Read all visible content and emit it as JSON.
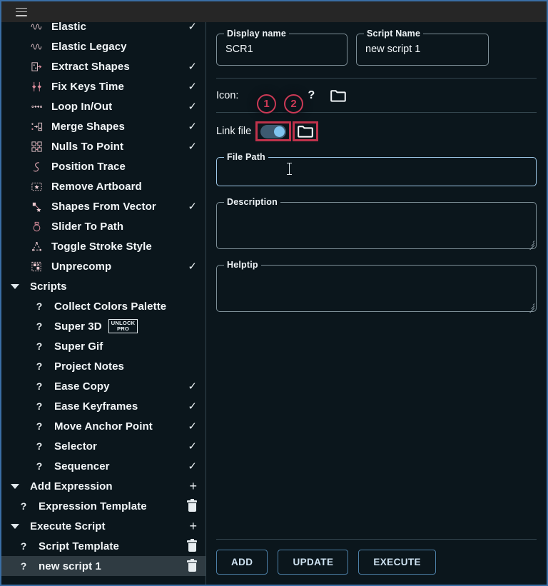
{
  "window": {
    "accent_blue": "#3a6ea5",
    "background": "#0b161c",
    "topbar_background": "#262626",
    "marker_color": "#cc3a56"
  },
  "topbar": {
    "menu_label": "menu"
  },
  "sidebar": {
    "items": [
      {
        "label": "Elastic",
        "icon": "wave-icon",
        "level": 1,
        "checked": true,
        "type": "tool"
      },
      {
        "label": "Elastic Legacy",
        "icon": "wave-icon",
        "level": 1,
        "checked": false,
        "type": "tool"
      },
      {
        "label": "Extract Shapes",
        "icon": "extract-shapes-icon",
        "level": 1,
        "checked": true,
        "type": "tool"
      },
      {
        "label": "Fix Keys Time",
        "icon": "fix-keys-time-icon",
        "level": 1,
        "checked": true,
        "type": "tool"
      },
      {
        "label": "Loop In/Out",
        "icon": "loop-in-out-icon",
        "level": 1,
        "checked": true,
        "type": "tool"
      },
      {
        "label": "Merge Shapes",
        "icon": "merge-shapes-icon",
        "level": 1,
        "checked": true,
        "type": "tool"
      },
      {
        "label": "Nulls To Point",
        "icon": "nulls-to-point-icon",
        "level": 1,
        "checked": true,
        "type": "tool"
      },
      {
        "label": "Position Trace",
        "icon": "position-trace-icon",
        "level": 1,
        "checked": false,
        "type": "tool"
      },
      {
        "label": "Remove Artboard",
        "icon": "remove-artboard-icon",
        "level": 1,
        "checked": false,
        "type": "tool"
      },
      {
        "label": "Shapes From Vector",
        "icon": "shapes-from-vector-icon",
        "level": 1,
        "checked": true,
        "type": "tool"
      },
      {
        "label": "Slider To Path",
        "icon": "slider-to-path-icon",
        "level": 1,
        "checked": false,
        "type": "tool"
      },
      {
        "label": "Toggle Stroke Style",
        "icon": "toggle-stroke-icon",
        "level": 1,
        "checked": false,
        "type": "tool"
      },
      {
        "label": "Unprecomp",
        "icon": "unprecomp-icon",
        "level": 1,
        "checked": true,
        "type": "tool"
      },
      {
        "label": "Scripts",
        "icon": "caret-down-icon",
        "level": 0,
        "checked": false,
        "type": "group"
      },
      {
        "label": "Collect Colors Palette",
        "icon": "question-icon",
        "level": 2,
        "checked": false,
        "type": "script"
      },
      {
        "label": "Super 3D",
        "icon": "question-icon",
        "level": 2,
        "checked": false,
        "type": "script",
        "badge": "UNLOCK PRO"
      },
      {
        "label": "Super Gif",
        "icon": "question-icon",
        "level": 2,
        "checked": false,
        "type": "script"
      },
      {
        "label": "Project Notes",
        "icon": "question-icon",
        "level": 2,
        "checked": false,
        "type": "script"
      },
      {
        "label": "Ease Copy",
        "icon": "question-icon",
        "level": 2,
        "checked": true,
        "type": "script"
      },
      {
        "label": "Ease Keyframes",
        "icon": "question-icon",
        "level": 2,
        "checked": true,
        "type": "script"
      },
      {
        "label": "Move Anchor Point",
        "icon": "question-icon",
        "level": 2,
        "checked": true,
        "type": "script"
      },
      {
        "label": "Selector",
        "icon": "question-icon",
        "level": 2,
        "checked": true,
        "type": "script"
      },
      {
        "label": "Sequencer",
        "icon": "question-icon",
        "level": 2,
        "checked": true,
        "type": "script"
      },
      {
        "label": "Add Expression",
        "icon": "caret-down-icon",
        "level": 0,
        "checked": false,
        "type": "group",
        "plus": "+"
      },
      {
        "label": "Expression Template",
        "icon": "question-icon",
        "level": 1,
        "checked": false,
        "type": "item",
        "trash": true
      },
      {
        "label": "Execute Script",
        "icon": "caret-down-icon",
        "level": 0,
        "checked": false,
        "type": "group",
        "plus": "+"
      },
      {
        "label": "Script Template",
        "icon": "question-icon",
        "level": 1,
        "checked": false,
        "type": "item",
        "trash": true
      },
      {
        "label": "new script 1",
        "icon": "question-icon",
        "level": 1,
        "checked": false,
        "type": "item",
        "trash": true,
        "selected": true
      }
    ],
    "badge_unlock_line1": "UNLOCK",
    "badge_unlock_line2": "PRO"
  },
  "main": {
    "display_name": {
      "legend": "Display name",
      "value": "SCR1"
    },
    "script_name": {
      "legend": "Script Name",
      "value": "new script 1"
    },
    "icon_row": {
      "label": "Icon:",
      "question": "?"
    },
    "link_file": {
      "label": "Link file",
      "toggle_on": true
    },
    "file_path": {
      "legend": "File Path",
      "value": ""
    },
    "description": {
      "legend": "Description",
      "value": ""
    },
    "helptip": {
      "legend": "Helptip",
      "value": ""
    },
    "markers": {
      "one": "1",
      "two": "2"
    },
    "buttons": {
      "add": "ADD",
      "update": "UPDATE",
      "execute": "EXECUTE"
    }
  }
}
